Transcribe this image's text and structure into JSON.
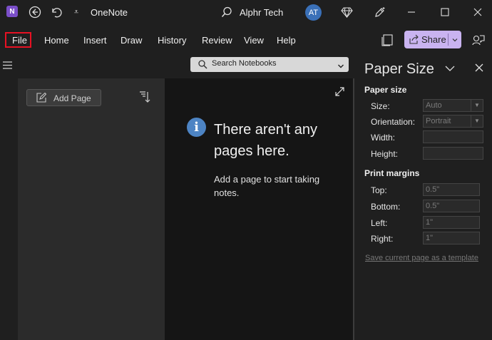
{
  "app": {
    "title": "OneNote",
    "logo_letter": "N"
  },
  "user": {
    "name": "Alphr Tech",
    "initials": "AT"
  },
  "menu": {
    "items": [
      "File",
      "Home",
      "Insert",
      "Draw",
      "History",
      "Review",
      "View",
      "Help"
    ]
  },
  "share": {
    "label": "Share"
  },
  "search": {
    "placeholder": "Search Notebooks"
  },
  "pages": {
    "add_label": "Add Page"
  },
  "empty_state": {
    "title": "There aren't any pages here.",
    "description": "Add a page to start taking notes."
  },
  "panel": {
    "title": "Paper Size",
    "paper_section": "Paper size",
    "size_label": "Size:",
    "size_value": "Auto",
    "orientation_label": "Orientation:",
    "orientation_value": "Portrait",
    "width_label": "Width:",
    "height_label": "Height:",
    "margins_section": "Print margins",
    "top_label": "Top:",
    "top_value": "0.5\"",
    "bottom_label": "Bottom:",
    "bottom_value": "0.5\"",
    "left_label": "Left:",
    "left_value": "1\"",
    "right_label": "Right:",
    "right_value": "1\"",
    "save_template": "Save current page as a template"
  },
  "colors": {
    "accent": "#7b4fc9",
    "share_bg": "#c9b3f0",
    "highlight": "#e81123",
    "info": "#4d84c4"
  }
}
